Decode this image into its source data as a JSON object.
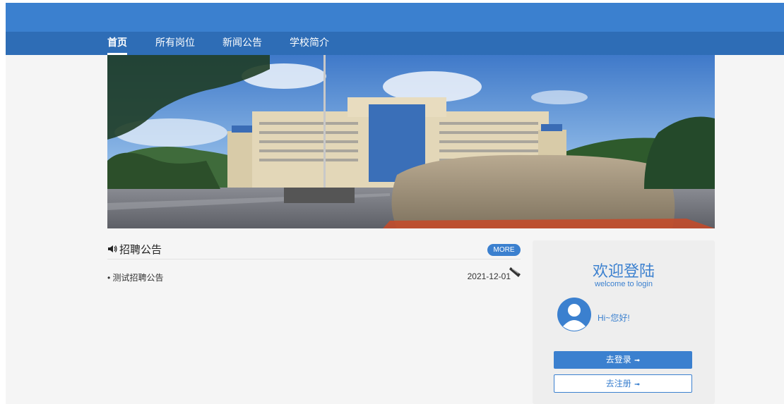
{
  "nav": {
    "items": [
      {
        "label": "首页",
        "active": true
      },
      {
        "label": "所有岗位",
        "active": false
      },
      {
        "label": "新闻公告",
        "active": false
      },
      {
        "label": "学校简介",
        "active": false
      }
    ]
  },
  "banner": {
    "alt": "校园主楼与校名石"
  },
  "notice": {
    "title": "招聘公告",
    "more_label": "MORE",
    "icon": "speaker-icon",
    "items": [
      {
        "title": "• 测试招聘公告",
        "date": "2021-12-01",
        "badge": "new-icon"
      }
    ]
  },
  "login": {
    "title": "欢迎登陆",
    "subtitle": "welcome to login",
    "greeting": "Hi~您好!",
    "login_label": "去登录",
    "register_label": "去注册",
    "arrow_icon": "arrow-right-icon"
  },
  "colors": {
    "primary": "#3b80cf",
    "nav": "#2e6db6",
    "panel": "#eeeeee",
    "page": "#f5f5f5"
  }
}
